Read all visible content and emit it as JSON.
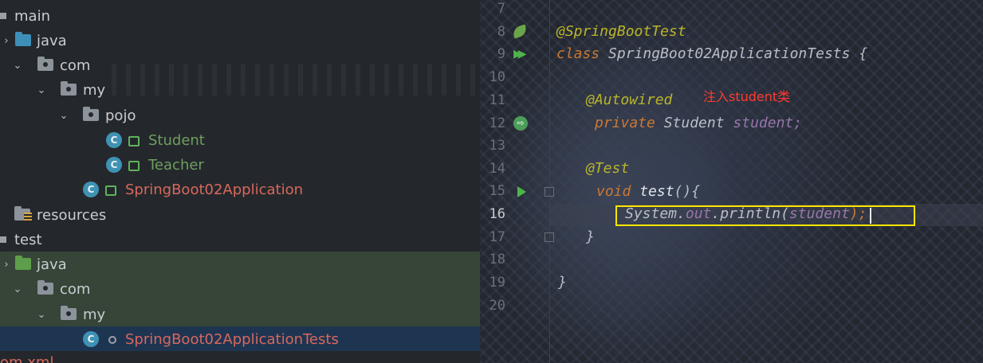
{
  "project_tree": {
    "items": [
      {
        "label": "main"
      },
      {
        "label": "java"
      },
      {
        "label": "com"
      },
      {
        "label": "my"
      },
      {
        "label": "pojo"
      },
      {
        "label": "Student"
      },
      {
        "label": "Teacher"
      },
      {
        "label": "SpringBoot02Application"
      },
      {
        "label": "resources"
      },
      {
        "label": "test"
      },
      {
        "label": "java"
      },
      {
        "label": "com"
      },
      {
        "label": "my"
      },
      {
        "label": "SpringBoot02ApplicationTests"
      },
      {
        "label": "om.xml"
      }
    ]
  },
  "editor": {
    "line_numbers": [
      "7",
      "8",
      "9",
      "10",
      "11",
      "12",
      "13",
      "14",
      "15",
      "16",
      "17",
      "18",
      "19",
      "20"
    ],
    "current_line": "16",
    "annotation_note": "注入student类",
    "code": {
      "l8_ann": "@SpringBootTest",
      "l9_kw": "class",
      "l9_name": " SpringBoot02ApplicationTests {",
      "l11_ann": "@Autowired",
      "l12_kw": "private",
      "l12_type": " Student ",
      "l12_field": "student;",
      "l14_ann": "@Test",
      "l15_kw": "void",
      "l15_method": " test",
      "l15_rest": "(){",
      "l16_sys": "System.",
      "l16_out": "out",
      "l16_println": ".println(",
      "l16_arg": "student",
      "l16_end": ");",
      "l17_brace": "}",
      "l19_brace": "}"
    }
  },
  "colors": {
    "annotation": "#bbb529",
    "keyword": "#cc7832",
    "field": "#9876aa",
    "highlight_box": "#ffe600",
    "note_text": "#ff3b30"
  },
  "icons": [
    "folder-icon",
    "package-icon",
    "class-icon",
    "lock-icon",
    "spring-leaf-icon",
    "run-icon",
    "autowire-icon"
  ]
}
